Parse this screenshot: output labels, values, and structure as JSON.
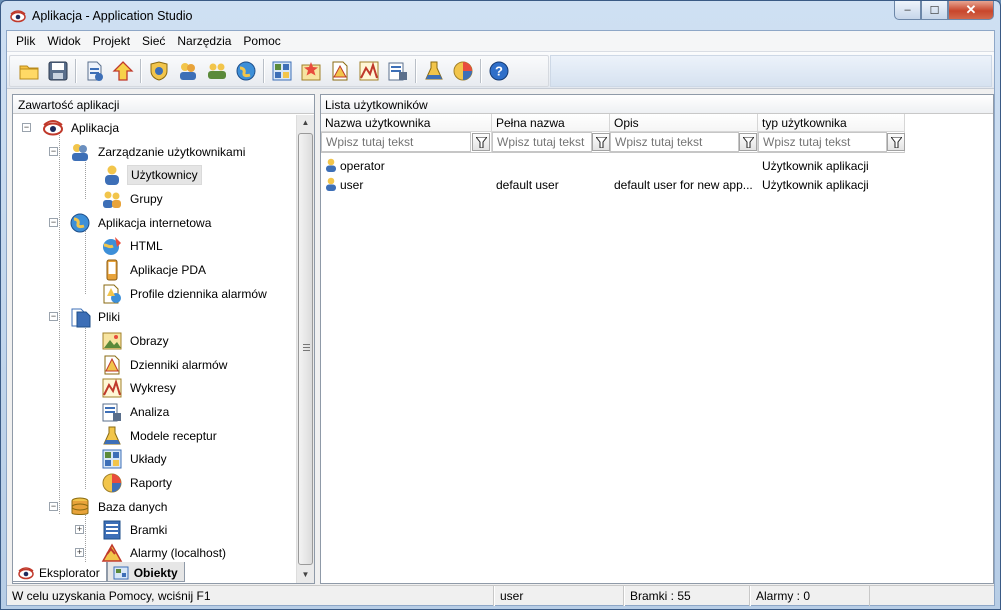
{
  "window": {
    "title": "Aplikacja - Application Studio",
    "min": "–",
    "max": "☐",
    "close": "✕"
  },
  "menu": [
    "Plik",
    "Widok",
    "Projekt",
    "Sieć",
    "Narzędzia",
    "Pomoc"
  ],
  "toolbar": {
    "buttons": [
      "open-folder-icon",
      "save-icon",
      "document-add-icon",
      "upload-icon",
      "shield-icon",
      "users-icon",
      "group-icon",
      "globe-icon",
      "layout-icon",
      "star-image-icon",
      "alarm-log-icon",
      "chart-icon",
      "recipe-icon",
      "flask-icon",
      "report-icon",
      "help-icon"
    ]
  },
  "left_panel": {
    "title": "Zawartość aplikacji",
    "tree": {
      "root": "Aplikacja",
      "user_mgmt": "Zarządzanie użytkownikami",
      "users": "Użytkownicy",
      "groups": "Grupy",
      "internet_app": "Aplikacja internetowa",
      "html": "HTML",
      "pda": "Aplikacje PDA",
      "alarm_profiles": "Profile dziennika alarmów",
      "files": "Pliki",
      "images": "Obrazy",
      "alarm_logs": "Dzienniki alarmów",
      "charts": "Wykresy",
      "analysis": "Analiza",
      "recipes": "Modele receptur",
      "layouts": "Układy",
      "reports": "Raporty",
      "database": "Baza danych",
      "gates": "Bramki",
      "alarms_local": "Alarmy (localhost)"
    },
    "tabs": {
      "explorer": "Eksplorator",
      "objects": "Obiekty"
    }
  },
  "right_panel": {
    "title": "Lista użytkowników",
    "columns": [
      "Nazwa użytkownika",
      "Pełna nazwa",
      "Opis",
      "typ użytkownika"
    ],
    "filter_placeholder": "Wpisz tutaj tekst",
    "rows": [
      {
        "name": "operator",
        "full_name": "",
        "description": "",
        "type": "Użytkownik aplikacji"
      },
      {
        "name": "user",
        "full_name": "default user",
        "description": "default user for new app...",
        "type": "Użytkownik aplikacji"
      }
    ]
  },
  "status": {
    "help": "W celu uzyskania Pomocy, wciśnij F1",
    "user": "user",
    "gates": "Bramki : 55",
    "alarms": "Alarmy : 0"
  }
}
